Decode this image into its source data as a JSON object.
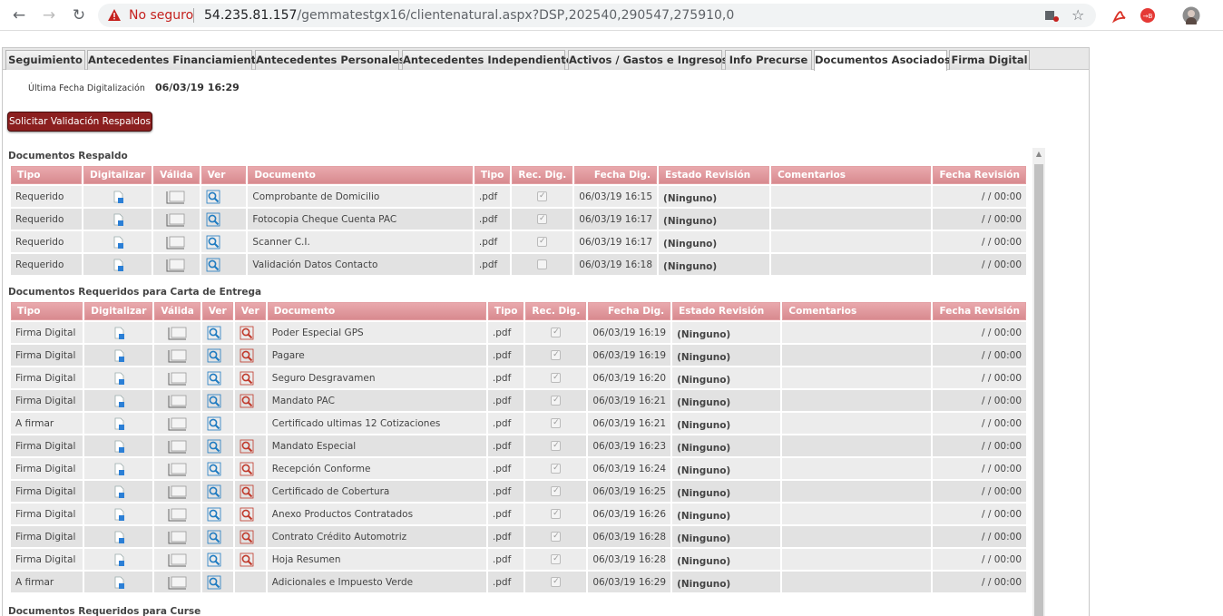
{
  "browser": {
    "insecure_label": "No seguro",
    "host": "54.235.81.157",
    "path": "/gemmatestgx16/clientenatural.aspx?DSP,202540,290547,275910,0",
    "icons": [
      "back-icon",
      "forward-icon",
      "reload-icon",
      "warning-icon",
      "extensions-icon",
      "star-icon",
      "pdf-icon",
      "extension-icon",
      "avatar"
    ]
  },
  "tabs": [
    {
      "label": "Seguimiento"
    },
    {
      "label": "Antecedentes Financiamiento"
    },
    {
      "label": "Antecedentes Personales"
    },
    {
      "label": "Antecedentes Independiente"
    },
    {
      "label": "Activos / Gastos e Ingresos"
    },
    {
      "label": "Info Precurse"
    },
    {
      "label": "Documentos Asociados"
    },
    {
      "label": "Firma Digital"
    }
  ],
  "header": {
    "last_digitization_label": "Última Fecha Digitalización",
    "last_digitization_value": "06/03/19 16:29",
    "request_button": "Solicitar Validación Respaldos"
  },
  "section1": {
    "title": "Documentos Respaldo",
    "columns": [
      "Tipo",
      "Digitalizar",
      "Válida",
      "Ver",
      "Documento",
      "Tipo",
      "Rec. Dig.",
      "Fecha Dig.",
      "Estado Revisión",
      "Comentarios",
      "Fecha Revisión"
    ],
    "rows": [
      {
        "tipo": "Requerido",
        "documento": "Comprobante de Domicilio",
        "ext": ".pdf",
        "rec": true,
        "fecha": "06/03/19 16:15",
        "estado": "(Ninguno)",
        "comentarios": "",
        "revision": "/ / 00:00"
      },
      {
        "tipo": "Requerido",
        "documento": "Fotocopia Cheque Cuenta PAC",
        "ext": ".pdf",
        "rec": true,
        "fecha": "06/03/19 16:17",
        "estado": "(Ninguno)",
        "comentarios": "",
        "revision": "/ / 00:00"
      },
      {
        "tipo": "Requerido",
        "documento": "Scanner C.I.",
        "ext": ".pdf",
        "rec": true,
        "fecha": "06/03/19 16:17",
        "estado": "(Ninguno)",
        "comentarios": "",
        "revision": "/ / 00:00"
      },
      {
        "tipo": "Requerido",
        "documento": "Validación Datos Contacto",
        "ext": ".pdf",
        "rec": false,
        "fecha": "06/03/19 16:18",
        "estado": "(Ninguno)",
        "comentarios": "",
        "revision": "/ / 00:00"
      }
    ]
  },
  "section2": {
    "title": "Documentos Requeridos para Carta de Entrega",
    "columns": [
      "Tipo",
      "Digitalizar",
      "Válida",
      "Ver",
      "Ver",
      "Documento",
      "Tipo",
      "Rec. Dig.",
      "Fecha Dig.",
      "Estado Revisión",
      "Comentarios",
      "Fecha Revisión"
    ],
    "rows": [
      {
        "tipo": "Firma Digital",
        "ver2": true,
        "documento": "Poder Especial GPS",
        "ext": ".pdf",
        "rec": true,
        "fecha": "06/03/19 16:19",
        "estado": "(Ninguno)",
        "comentarios": "",
        "revision": "/ / 00:00"
      },
      {
        "tipo": "Firma Digital",
        "ver2": true,
        "documento": "Pagare",
        "ext": ".pdf",
        "rec": true,
        "fecha": "06/03/19 16:19",
        "estado": "(Ninguno)",
        "comentarios": "",
        "revision": "/ / 00:00"
      },
      {
        "tipo": "Firma Digital",
        "ver2": true,
        "documento": "Seguro Desgravamen",
        "ext": ".pdf",
        "rec": true,
        "fecha": "06/03/19 16:20",
        "estado": "(Ninguno)",
        "comentarios": "",
        "revision": "/ / 00:00"
      },
      {
        "tipo": "Firma Digital",
        "ver2": true,
        "documento": "Mandato PAC",
        "ext": ".pdf",
        "rec": true,
        "fecha": "06/03/19 16:21",
        "estado": "(Ninguno)",
        "comentarios": "",
        "revision": "/ / 00:00"
      },
      {
        "tipo": "A firmar",
        "ver2": false,
        "documento": "Certificado ultimas 12 Cotizaciones",
        "ext": ".pdf",
        "rec": true,
        "fecha": "06/03/19 16:21",
        "estado": "(Ninguno)",
        "comentarios": "",
        "revision": "/ / 00:00"
      },
      {
        "tipo": "Firma Digital",
        "ver2": true,
        "documento": "Mandato Especial",
        "ext": ".pdf",
        "rec": true,
        "fecha": "06/03/19 16:23",
        "estado": "(Ninguno)",
        "comentarios": "",
        "revision": "/ / 00:00"
      },
      {
        "tipo": "Firma Digital",
        "ver2": true,
        "documento": "Recepción Conforme",
        "ext": ".pdf",
        "rec": true,
        "fecha": "06/03/19 16:24",
        "estado": "(Ninguno)",
        "comentarios": "",
        "revision": "/ / 00:00"
      },
      {
        "tipo": "Firma Digital",
        "ver2": true,
        "documento": "Certificado de Cobertura",
        "ext": ".pdf",
        "rec": true,
        "fecha": "06/03/19 16:25",
        "estado": "(Ninguno)",
        "comentarios": "",
        "revision": "/ / 00:00"
      },
      {
        "tipo": "Firma Digital",
        "ver2": true,
        "documento": "Anexo Productos Contratados",
        "ext": ".pdf",
        "rec": true,
        "fecha": "06/03/19 16:26",
        "estado": "(Ninguno)",
        "comentarios": "",
        "revision": "/ / 00:00"
      },
      {
        "tipo": "Firma Digital",
        "ver2": true,
        "documento": "Contrato Crédito Automotriz",
        "ext": ".pdf",
        "rec": true,
        "fecha": "06/03/19 16:28",
        "estado": "(Ninguno)",
        "comentarios": "",
        "revision": "/ / 00:00"
      },
      {
        "tipo": "Firma Digital",
        "ver2": true,
        "documento": "Hoja Resumen",
        "ext": ".pdf",
        "rec": true,
        "fecha": "06/03/19 16:28",
        "estado": "(Ninguno)",
        "comentarios": "",
        "revision": "/ / 00:00"
      },
      {
        "tipo": "A firmar",
        "ver2": false,
        "documento": "Adicionales e Impuesto Verde",
        "ext": ".pdf",
        "rec": true,
        "fecha": "06/03/19 16:29",
        "estado": "(Ninguno)",
        "comentarios": "",
        "revision": "/ / 00:00"
      }
    ]
  },
  "section3": {
    "title": "Documentos Requeridos para Curse"
  },
  "colors": {
    "header_pink": "#d88a8f",
    "button_red": "#8b1f1f",
    "insecure_red": "#c5221f"
  }
}
